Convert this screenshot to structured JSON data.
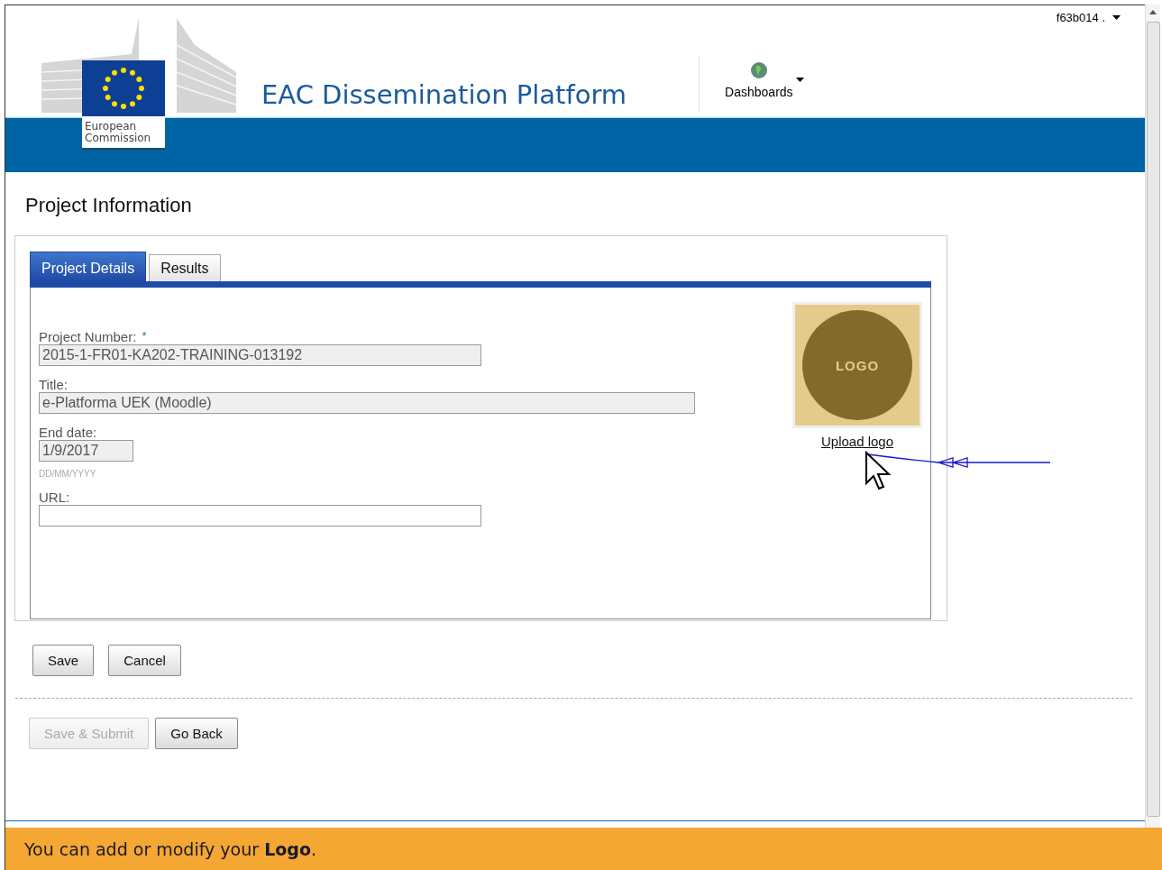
{
  "header": {
    "org_name": "European Commission",
    "title": "EAC Dissemination Platform",
    "user_menu": "f63b014 .",
    "nav": [
      {
        "label": "Dashboards"
      }
    ]
  },
  "page_title": "Project Information",
  "tabs": [
    {
      "label": "Project Details",
      "selected": true
    },
    {
      "label": "Results",
      "selected": false
    }
  ],
  "fields": [
    {
      "label": "Project Number:",
      "required_mark": "*",
      "value": "2015-1-FR01-KA202-TRAINING-013192",
      "disabled": true
    },
    {
      "label": "Title:",
      "value": "e-Platforma UEK (Moodle)",
      "disabled": true
    },
    {
      "label": "End date:",
      "value": "1/9/2017",
      "hint": "DD/MM/YYYY",
      "disabled": true
    },
    {
      "label": "URL:",
      "disabled": false
    }
  ],
  "logo": {
    "placeholder": "LOGO",
    "link": "Upload logo"
  },
  "buttons": [
    {
      "label": "Save",
      "disabled": false
    },
    {
      "label": "Cancel",
      "disabled": false
    }
  ],
  "buttons_bottom": [
    {
      "label": "Save & Submit",
      "disabled": true
    },
    {
      "label": "Go Back",
      "disabled": false
    }
  ],
  "banner": {
    "text": "You can add or modify your **Logo**."
  }
}
